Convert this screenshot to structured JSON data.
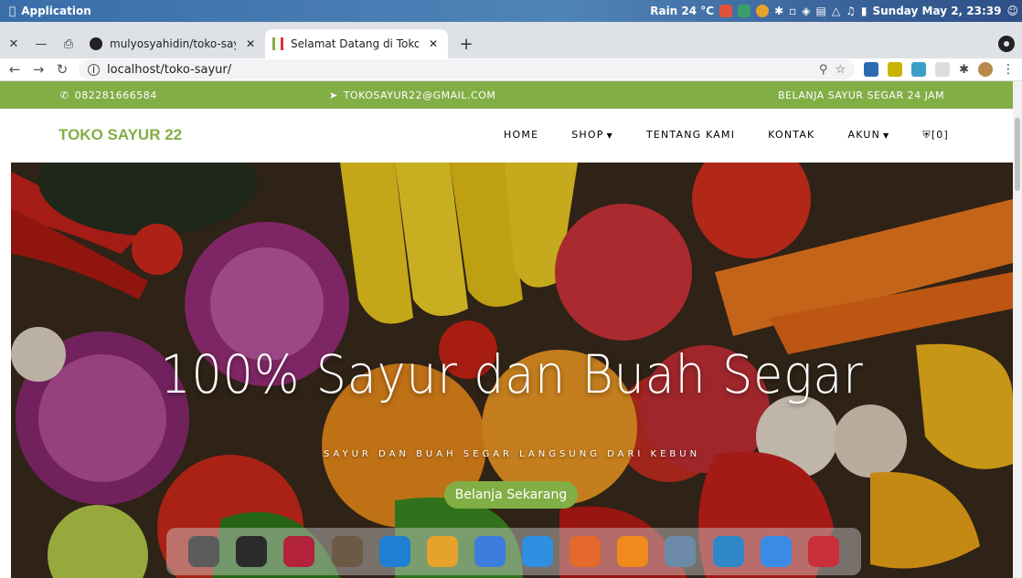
{
  "os": {
    "app_menu": "Application",
    "weather": "Rain 24 °C",
    "clock": "Sunday May  2, 23:39"
  },
  "tabs": [
    {
      "title": "mulyosyahidin/toko-sayur",
      "icon": "github-icon"
    },
    {
      "title": "Selamat Datang di Toko Sayur",
      "icon": "store-favicon"
    }
  ],
  "toolbar": {
    "url": "localhost/toko-sayur/"
  },
  "topbar": {
    "phone": "082281666584",
    "email": "TOKOSAYUR22@GMAIL.COM",
    "tagline": "BELANJA SAYUR SEGAR 24 JAM"
  },
  "navbar": {
    "brand": "TOKO SAYUR 22",
    "links": [
      "HOME",
      "SHOP",
      "TENTANG KAMI",
      "KONTAK",
      "AKUN"
    ],
    "cart": "[0]"
  },
  "hero": {
    "title": "100% Sayur dan Buah Segar",
    "subtitle": "SAYUR DAN BUAH SEGAR LANGSUNG DARI KEBUN",
    "button": "Belanja Sekarang"
  },
  "colors": {
    "accent": "#82ae46"
  },
  "dock": [
    {
      "name": "screenshot-icon",
      "color": "#5c5c5c"
    },
    {
      "name": "terminal-icon",
      "color": "#2b2b2b"
    },
    {
      "name": "mendeley-icon",
      "color": "#b2223a"
    },
    {
      "name": "gimp-icon",
      "color": "#6b5b45"
    },
    {
      "name": "vscode-icon",
      "color": "#1f7fd0"
    },
    {
      "name": "chrome-icon",
      "color": "#e6a32c"
    },
    {
      "name": "wps-writer-icon",
      "color": "#3d7dde"
    },
    {
      "name": "files-icon",
      "color": "#2f8fe0"
    },
    {
      "name": "firefox-icon",
      "color": "#e5682c"
    },
    {
      "name": "vlc-icon",
      "color": "#f08a1c"
    },
    {
      "name": "scanner-icon",
      "color": "#6d8aa8"
    },
    {
      "name": "document-viewer-icon",
      "color": "#2f86c8"
    },
    {
      "name": "finder-icon",
      "color": "#3a8ae6"
    },
    {
      "name": "text-editor-icon",
      "color": "#c9303a"
    }
  ]
}
